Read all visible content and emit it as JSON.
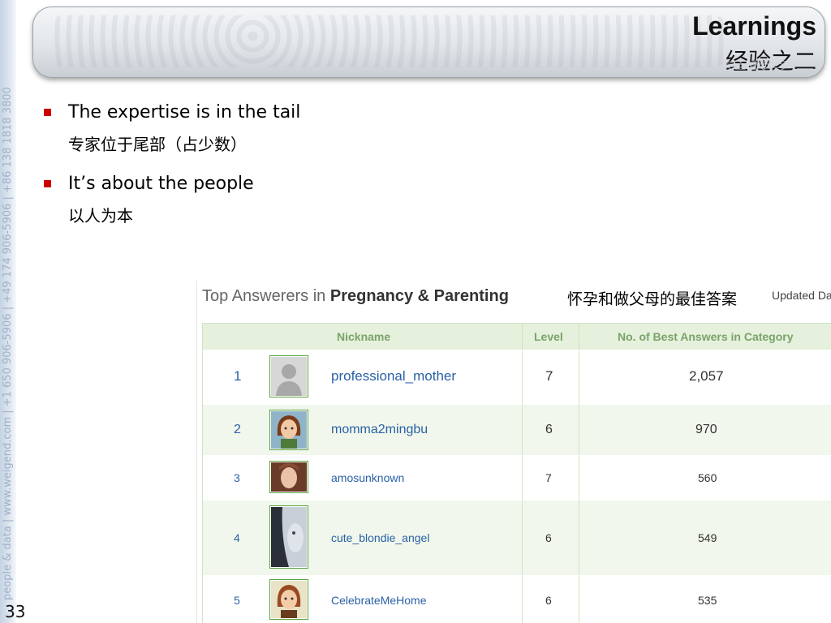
{
  "sidebar": {
    "vertical_text": "people & data  |  www.weigend.com  |  +1 650 906-5906  |  +49 174 906-5906  |  +86 138 1818 3800",
    "page_number": "33"
  },
  "header": {
    "title_en": "Learnings",
    "title_zh": "经验之二"
  },
  "bullets": [
    {
      "en": "The expertise is in the tail",
      "zh": "专家位于尾部（占少数）"
    },
    {
      "en": "It’s about the people",
      "zh": "以人为本"
    }
  ],
  "panel": {
    "title_prefix": "Top Answerers in ",
    "title_category": "Pregnancy & Parenting",
    "title_zh": "怀孕和做父母的最佳答案",
    "updated": "Updated Da",
    "columns": [
      "Nickname",
      "Level",
      "No. of Best Answers in Category"
    ],
    "rows": [
      {
        "rank": "1",
        "nickname": "professional_mother",
        "level": "7",
        "answers": "2,057",
        "avatar": "default-silhouette-icon"
      },
      {
        "rank": "2",
        "nickname": "momma2mingbu",
        "level": "6",
        "answers": "970",
        "avatar": "cartoon-woman-avatar"
      },
      {
        "rank": "3",
        "nickname": "amosunknown",
        "level": "7",
        "answers": "560",
        "avatar": "photo-avatar"
      },
      {
        "rank": "4",
        "nickname": "cute_blondie_angel",
        "level": "6",
        "answers": "549",
        "avatar": "photo-avatar"
      },
      {
        "rank": "5",
        "nickname": "CelebrateMeHome",
        "level": "6",
        "answers": "535",
        "avatar": "cartoon-woman-avatar"
      }
    ]
  },
  "colors": {
    "bullet_marker": "#cc0000",
    "table_header_bg": "#e5f1dc",
    "table_header_text": "#7aa36a",
    "link_blue": "#2a61a6"
  }
}
